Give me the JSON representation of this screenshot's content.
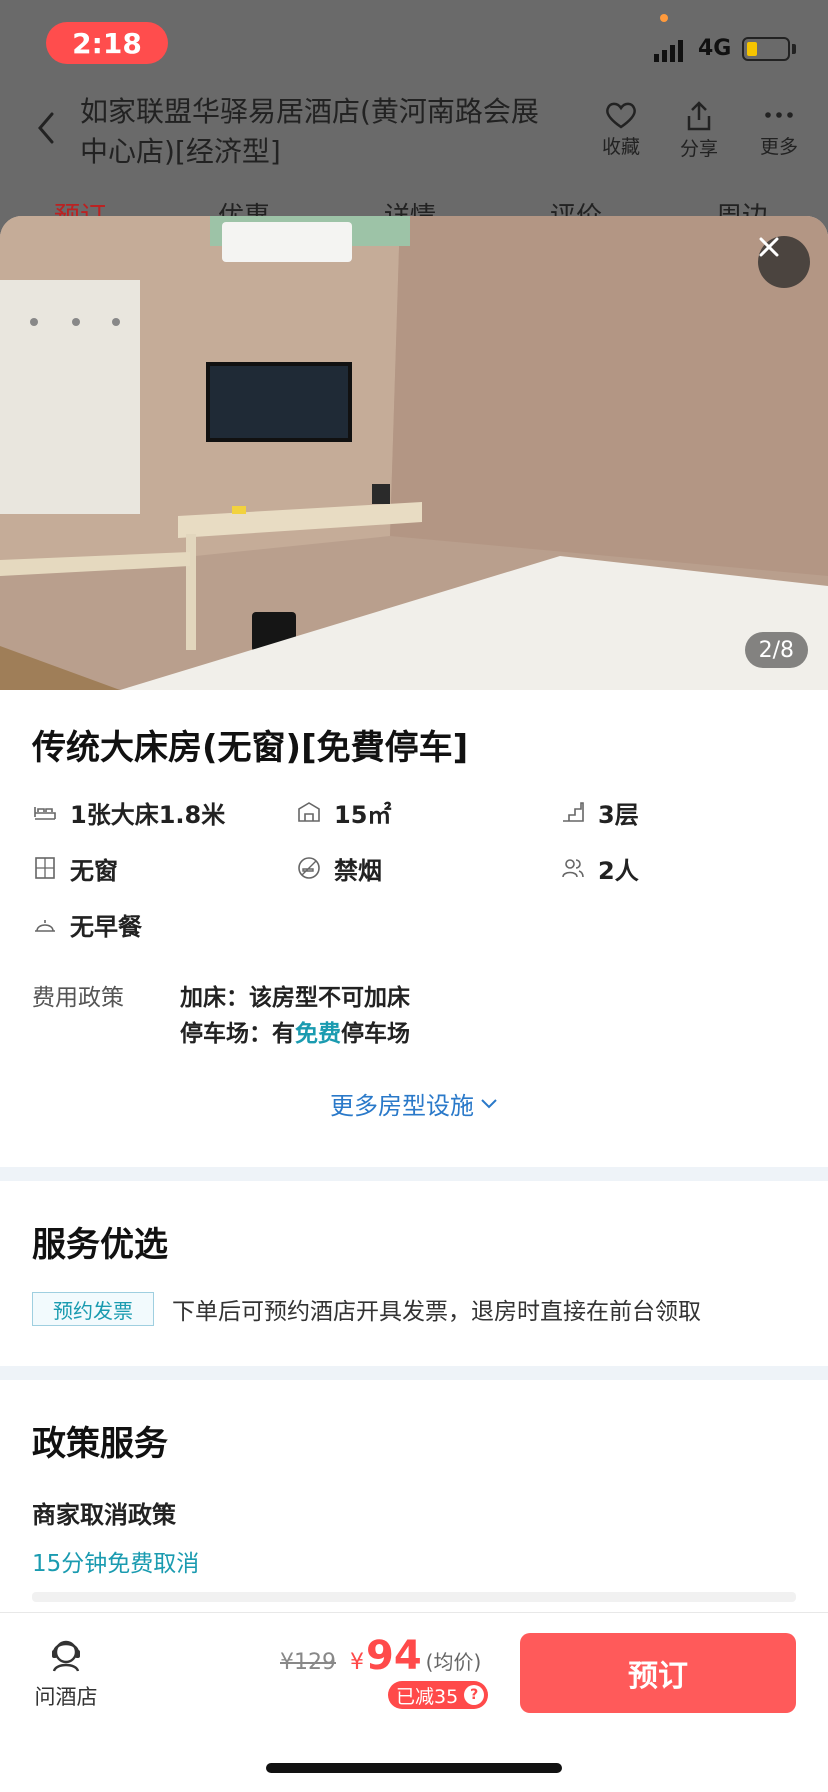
{
  "status_bar": {
    "time": "2:18",
    "network": "4G"
  },
  "header": {
    "hotel_name": "如家联盟华驿易居酒店(黄河南路会展中心店)[经济型]",
    "actions": [
      {
        "label": "收藏",
        "icon": "heart-icon"
      },
      {
        "label": "分享",
        "icon": "share-icon"
      },
      {
        "label": "更多",
        "icon": "more-icon"
      }
    ],
    "tabs": [
      "预订",
      "优惠",
      "详情",
      "评价",
      "周边"
    ]
  },
  "gallery": {
    "counter": "2/8"
  },
  "room": {
    "title": "传统大床房(无窗)[免費停车]",
    "facilities": [
      {
        "icon": "bed-icon",
        "text": "1张大床1.8米"
      },
      {
        "icon": "area-icon",
        "text": "15㎡"
      },
      {
        "icon": "floor-icon",
        "text": "3层"
      },
      {
        "icon": "window-icon",
        "text": "无窗"
      },
      {
        "icon": "no-smoking-icon",
        "text": "禁烟"
      },
      {
        "icon": "guests-icon",
        "text": "2人"
      },
      {
        "icon": "breakfast-icon",
        "text": "无早餐"
      }
    ],
    "fee_policy": {
      "label": "费用政策",
      "extra_bed": "加床：该房型不可加床",
      "parking_prefix": "停车场：有",
      "parking_free": "免费",
      "parking_suffix": "停车场"
    },
    "more_link": "更多房型设施"
  },
  "service": {
    "title": "服务优选",
    "tag": "预约发票",
    "text": "下单后可预约酒店开具发票，退房时直接在前台领取"
  },
  "policy": {
    "title": "政策服务",
    "subtitle": "商家取消政策",
    "value": "15分钟免费取消"
  },
  "bottom": {
    "ask_label": "问酒店",
    "old_price": "¥129",
    "currency": "¥",
    "price": "94",
    "avg_label": "(均价)",
    "saved": "已减35",
    "saved_help": "?",
    "book_label": "预订"
  },
  "colors": {
    "accent_red": "#ff5a5a",
    "link_blue": "#2a79c9",
    "teal": "#1a9bb0"
  }
}
